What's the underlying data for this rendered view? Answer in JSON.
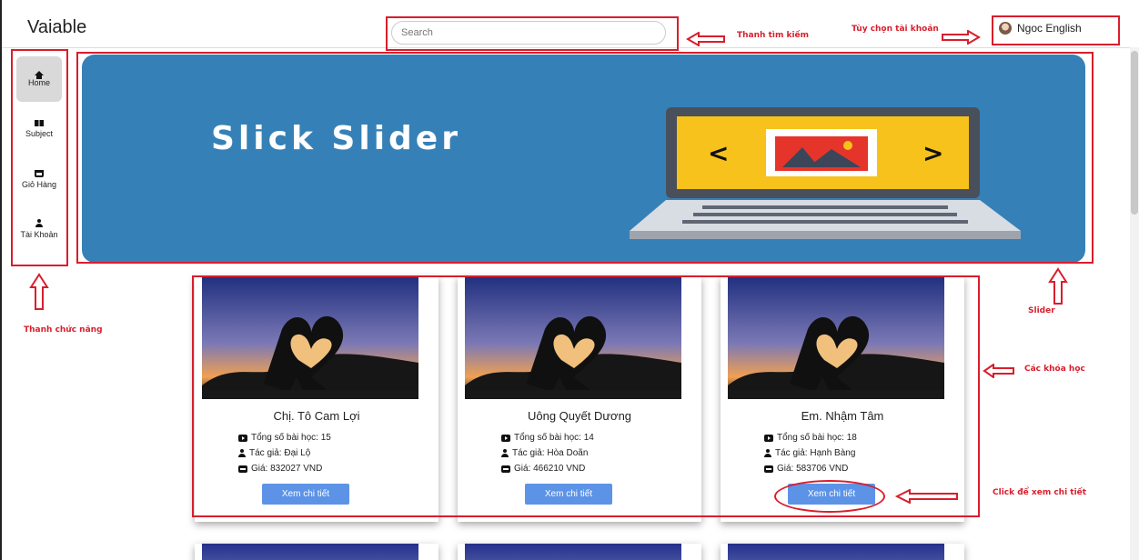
{
  "header": {
    "brand": "Vaiable",
    "search_placeholder": "Search",
    "user_name": "Ngoc English"
  },
  "sidebar": {
    "items": [
      {
        "label": "Home",
        "icon": "home-icon",
        "active": true
      },
      {
        "label": "Subject",
        "icon": "book-icon",
        "active": false
      },
      {
        "label": "Giỏ Hàng",
        "icon": "cart-icon",
        "active": false
      },
      {
        "label": "Tài Khoản",
        "icon": "user-icon",
        "active": false
      }
    ]
  },
  "slider": {
    "title": "Slick Slider",
    "prev_glyph": "<",
    "next_glyph": ">"
  },
  "courses": [
    {
      "title": "Chị. Tô Cam Lợi",
      "lessons": "Tổng số bài học: 15",
      "author": "Tác giả: Đại Lộ",
      "price": "Giá: 832027 VND",
      "button": "Xem chi tiết"
    },
    {
      "title": "Uông Quyết Dương",
      "lessons": "Tổng số bài học: 14",
      "author": "Tác giả: Hòa Doãn",
      "price": "Giá: 466210 VND",
      "button": "Xem chi tiết"
    },
    {
      "title": "Em. Nhậm Tâm",
      "lessons": "Tổng số bài học: 18",
      "author": "Tác giả: Hạnh Bàng",
      "price": "Giá: 583706 VND",
      "button": "Xem chi tiết"
    }
  ],
  "annotations": {
    "search": "Thanh tìm kiếm",
    "account": "Tùy chọn tài khoản",
    "slider": "Slider",
    "sidebar": "Thanh chức năng",
    "courses": "Các khóa học",
    "detail": "Click để xem chi tiết"
  },
  "colors": {
    "annotation": "#d91e2c",
    "slider_bg": "#3581b7",
    "button": "#5c93e7"
  }
}
